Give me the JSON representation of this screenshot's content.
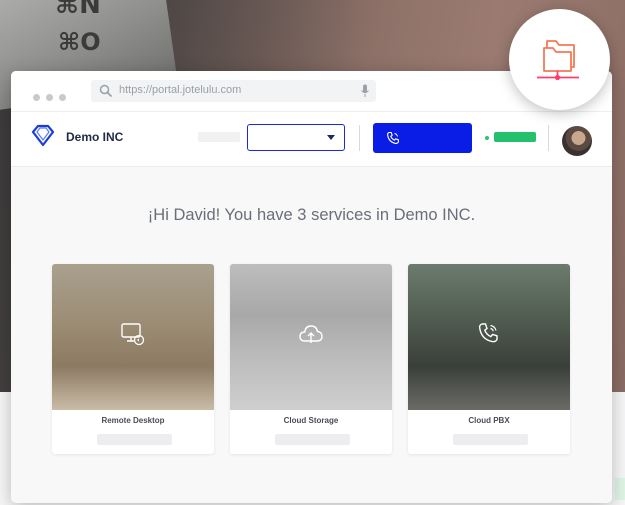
{
  "keyboard": {
    "key_top": "⌘N",
    "key_bottom": "⌘O"
  },
  "browser": {
    "url_text": "https://portal.jotelulu.com"
  },
  "header": {
    "brand": "Demo INC"
  },
  "main": {
    "greeting": "¡Hi David! You have 3 services in Demo INC."
  },
  "services": [
    {
      "label": "Remote Desktop",
      "icon": "monitor-icon"
    },
    {
      "label": "Cloud Storage",
      "icon": "cloud-upload-icon"
    },
    {
      "label": "Cloud PBX",
      "icon": "phone-icon"
    }
  ],
  "badge": {
    "icon": "network-folder-icon"
  },
  "colors": {
    "accent_blue": "#0a1de6",
    "status_green": "#23c16b",
    "folder_orange": "#f27a55",
    "folder_pink": "#ff3d6e"
  }
}
